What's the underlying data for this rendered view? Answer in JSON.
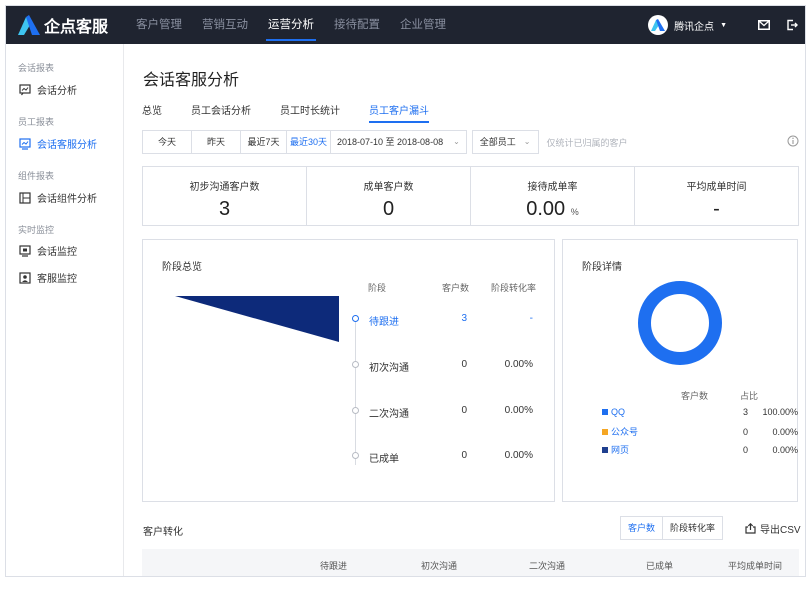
{
  "app": {
    "title": "企点客服"
  },
  "top_nav": [
    "客户管理",
    "营销互动",
    "运营分析",
    "接待配置",
    "企业管理"
  ],
  "top_right": {
    "org": "腾讯企点"
  },
  "sidebar": {
    "groups": [
      {
        "title": "会话报表",
        "items": [
          {
            "label": "会话分析",
            "icon": "chat-chart-icon"
          }
        ]
      },
      {
        "title": "员工报表",
        "items": [
          {
            "label": "会话客服分析",
            "icon": "monitor-chart-icon",
            "active": true
          }
        ]
      },
      {
        "title": "组件报表",
        "items": [
          {
            "label": "会话组件分析",
            "icon": "component-icon"
          }
        ]
      },
      {
        "title": "实时监控",
        "items": [
          {
            "label": "会话监控",
            "icon": "screen-icon"
          },
          {
            "label": "客服监控",
            "icon": "agent-icon"
          }
        ]
      }
    ]
  },
  "page": {
    "title": "会话客服分析",
    "tabs": [
      "总览",
      "员工会话分析",
      "员工时长统计",
      "员工客户漏斗"
    ]
  },
  "filters": {
    "quick": [
      "今天",
      "昨天",
      "最近7天",
      "最近30天"
    ],
    "date_range": "2018-07-10 至 2018-08-08",
    "staff": "全部员工",
    "hint": "仅统计已归属的客户"
  },
  "kpis": [
    {
      "label": "初步沟通客户数",
      "value": "3",
      "unit": ""
    },
    {
      "label": "成单客户数",
      "value": "0",
      "unit": ""
    },
    {
      "label": "接待成单率",
      "value": "0.00",
      "unit": "%"
    },
    {
      "label": "平均成单时间",
      "value": "-",
      "unit": ""
    }
  ],
  "overview": {
    "title": "阶段总览",
    "columns": [
      "阶段",
      "客户数",
      "阶段转化率"
    ],
    "stages": [
      {
        "name": "待跟进",
        "count": "3",
        "rate": "-",
        "active": true
      },
      {
        "name": "初次沟通",
        "count": "0",
        "rate": "0.00%"
      },
      {
        "name": "二次沟通",
        "count": "0",
        "rate": "0.00%"
      },
      {
        "name": "已成单",
        "count": "0",
        "rate": "0.00%"
      }
    ]
  },
  "detail": {
    "title": "阶段详情",
    "columns": [
      "客户数",
      "占比"
    ],
    "rows": [
      {
        "name": "QQ",
        "count": "3",
        "pct": "100.00%",
        "color": "#1e6ff0"
      },
      {
        "name": "公众号",
        "count": "0",
        "pct": "0.00%",
        "color": "#f5a623"
      },
      {
        "name": "网页",
        "count": "0",
        "pct": "0.00%",
        "color": "#1f3f8f"
      }
    ]
  },
  "conversion": {
    "title": "客户转化",
    "toggle": [
      "客户数",
      "阶段转化率"
    ],
    "export": "导出CSV",
    "columns": [
      "待跟进",
      "初次沟通",
      "二次沟通",
      "已成单",
      "平均成单时间"
    ]
  },
  "colors": {
    "accent": "#1e6ff0",
    "topbar": "#1f2430",
    "funnel": "#0d2a7a"
  }
}
